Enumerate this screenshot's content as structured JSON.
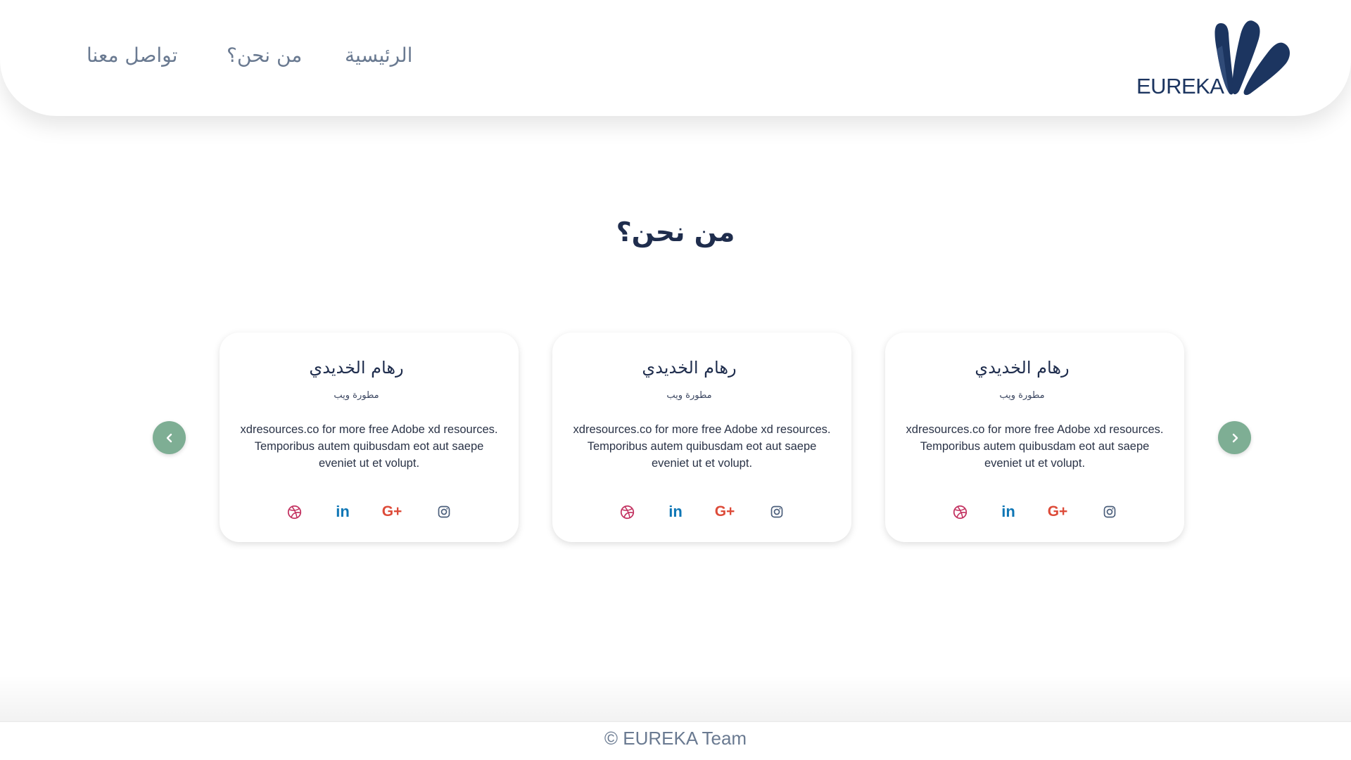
{
  "header": {
    "nav": {
      "home": "الرئيسية",
      "about": "من نحن؟",
      "contact": "تواصل معنا"
    },
    "logo_text": "EUREKA"
  },
  "section": {
    "title": "من نحن؟"
  },
  "cards": [
    {
      "name": "رهام الخديدي",
      "role": "مطورة ويب",
      "description": "xdresources.co for more free Adobe xd resources. Temporibus autem quibusdam eot aut saepe eveniet ut et  volupt.",
      "social": {
        "linkedin": "in",
        "gplus": "G+"
      }
    },
    {
      "name": "رهام الخديدي",
      "role": "مطورة ويب",
      "description": "xdresources.co for more free Adobe xd resources. Temporibus autem quibusdam eot aut saepe eveniet ut et  volupt.",
      "social": {
        "linkedin": "in",
        "gplus": "G+"
      }
    },
    {
      "name": "رهام الخديدي",
      "role": "مطورة ويب",
      "description": "xdresources.co for more free Adobe xd resources. Temporibus autem quibusdam eot aut saepe eveniet ut et  volupt.",
      "social": {
        "linkedin": "in",
        "gplus": "G+"
      }
    }
  ],
  "icons": {
    "dribbble": "dribbble-icon",
    "linkedin": "linkedin-icon",
    "gplus": "google-plus-icon",
    "instagram": "instagram-icon",
    "prev": "chevron-left-icon",
    "next": "chevron-right-icon"
  },
  "colors": {
    "brand_navy": "#1c3560",
    "nav_text": "#6a7a91",
    "arrow_green": "#7eae94",
    "dribbble": "#c2305f",
    "linkedin": "#0e76b5",
    "gplus": "#dd4b39",
    "instagram": "#4a5d7a"
  },
  "footer": {
    "text": "© EUREKA Team"
  }
}
